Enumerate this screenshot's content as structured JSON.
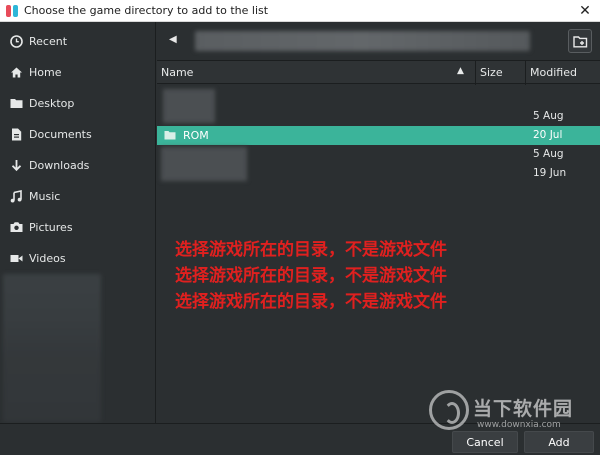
{
  "window": {
    "title": "Choose the game directory to add to the list",
    "close_glyph": "✕"
  },
  "sidebar": {
    "items": [
      {
        "label": "Recent",
        "icon": "clock-icon"
      },
      {
        "label": "Home",
        "icon": "home-icon"
      },
      {
        "label": "Desktop",
        "icon": "folder-icon"
      },
      {
        "label": "Documents",
        "icon": "document-icon"
      },
      {
        "label": "Downloads",
        "icon": "download-arrow-icon"
      },
      {
        "label": "Music",
        "icon": "music-note-icon"
      },
      {
        "label": "Pictures",
        "icon": "camera-icon"
      },
      {
        "label": "Videos",
        "icon": "video-icon"
      }
    ]
  },
  "pathbar": {
    "back_glyph": "◀"
  },
  "filelist": {
    "columns": {
      "name": "Name",
      "size": "Size",
      "modified": "Modified"
    },
    "sort_glyph": "▲",
    "rows": [
      {
        "name": "",
        "modified": "5 Aug",
        "selected": false
      },
      {
        "name": "ROM",
        "modified": "20 Jul",
        "selected": true
      },
      {
        "name": "",
        "modified": "5 Aug",
        "selected": false
      },
      {
        "name": "",
        "modified": "19 Jun",
        "selected": false
      }
    ]
  },
  "annotation": {
    "lines": [
      "选择游戏所在的目录，不是游戏文件",
      "选择游戏所在的目录，不是游戏文件",
      "选择游戏所在的目录，不是游戏文件"
    ],
    "color": "#e0201f"
  },
  "buttons": {
    "cancel": "Cancel",
    "add": "Add"
  },
  "watermark": {
    "brand": "当下软件园",
    "url": "www.downxia.com"
  },
  "colors": {
    "background": "#2b2f31",
    "accent": "#3bb49a"
  }
}
